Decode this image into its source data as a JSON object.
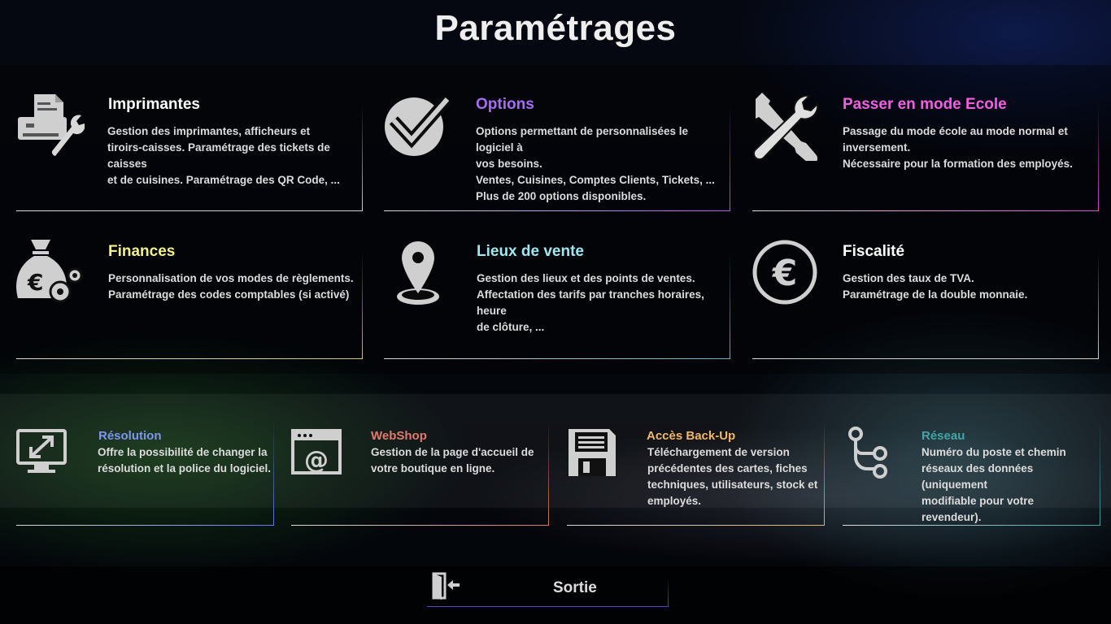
{
  "page": {
    "title": "Paramétrages"
  },
  "tiles": [
    {
      "title": "Imprimantes",
      "color": "#ffffff",
      "line": "#cfcfcf",
      "icon": "printer-wrench-icon",
      "desc": [
        "Gestion des imprimantes, afficheurs et",
        "tiroirs-caisses. Paramétrage des tickets de caisses",
        "et de cuisines. Paramétrage des QR Code, ..."
      ]
    },
    {
      "title": "Options",
      "color": "#a86df5",
      "line": "#a45cf0",
      "icon": "checkmark-circle-icon",
      "desc": [
        "Options permettant de personnalisées le logiciel à",
        "vos besoins.",
        "Ventes, Cuisines, Comptes Clients, Tickets, ...",
        "Plus de 200 options disponibles."
      ]
    },
    {
      "title": "Passer en mode Ecole",
      "color": "#f060e0",
      "line": "#d84fd0",
      "icon": "tools-icon",
      "desc": [
        "Passage du mode école au mode normal et",
        "inversement.",
        "Nécessaire pour la formation des employés."
      ]
    },
    {
      "title": "Finances",
      "color": "#f4f08a",
      "line": "#d8c86a",
      "icon": "money-bag-gears-icon",
      "desc": [
        "Personnalisation de vos modes de règlements.",
        "Paramétrage des codes comptables (si activé)"
      ]
    },
    {
      "title": "Lieux de vente",
      "color": "#9fe8f0",
      "line": "#5fb4c8",
      "icon": "map-pin-icon",
      "desc": [
        "Gestion des lieux et des points de ventes.",
        "Affectation des tarifs par tranches horaires, heure",
        "de clôture, ..."
      ]
    },
    {
      "title": "Fiscalité",
      "color": "#ffffff",
      "line": "#cfcfcf",
      "icon": "euro-circle-icon",
      "desc": [
        "Gestion des taux de TVA.",
        "Paramétrage de la double monnaie."
      ]
    }
  ],
  "small_tiles": [
    {
      "title": "Résolution",
      "color": "#7f95f0",
      "line": "#5f7cf0",
      "icon": "monitor-resize-icon",
      "desc": [
        "Offre la possibilité de changer la",
        "résolution et la police du logiciel."
      ]
    },
    {
      "title": "WebShop",
      "color": "#e27a6f",
      "line": "#d87a60",
      "icon": "web-browser-at-icon",
      "desc": [
        "Gestion de la page d'accueil de",
        "votre boutique en ligne."
      ]
    },
    {
      "title": "Accès Back-Up",
      "color": "#f2b86a",
      "line": "#e0b070",
      "icon": "floppy-disk-icon",
      "desc": [
        "Téléchargement de version",
        "précédentes des cartes, fiches",
        "techniques, utilisateurs, stock et",
        "employés."
      ]
    },
    {
      "title": "Réseau",
      "color": "#3fa6a6",
      "line": "#3fa6a6",
      "icon": "network-branch-icon",
      "desc": [
        "Numéro du poste et chemin",
        "réseaux des données (uniquement",
        "modifiable pour votre revendeur)."
      ]
    }
  ],
  "exit": {
    "label": "Sortie",
    "icon": "exit-door-icon"
  }
}
